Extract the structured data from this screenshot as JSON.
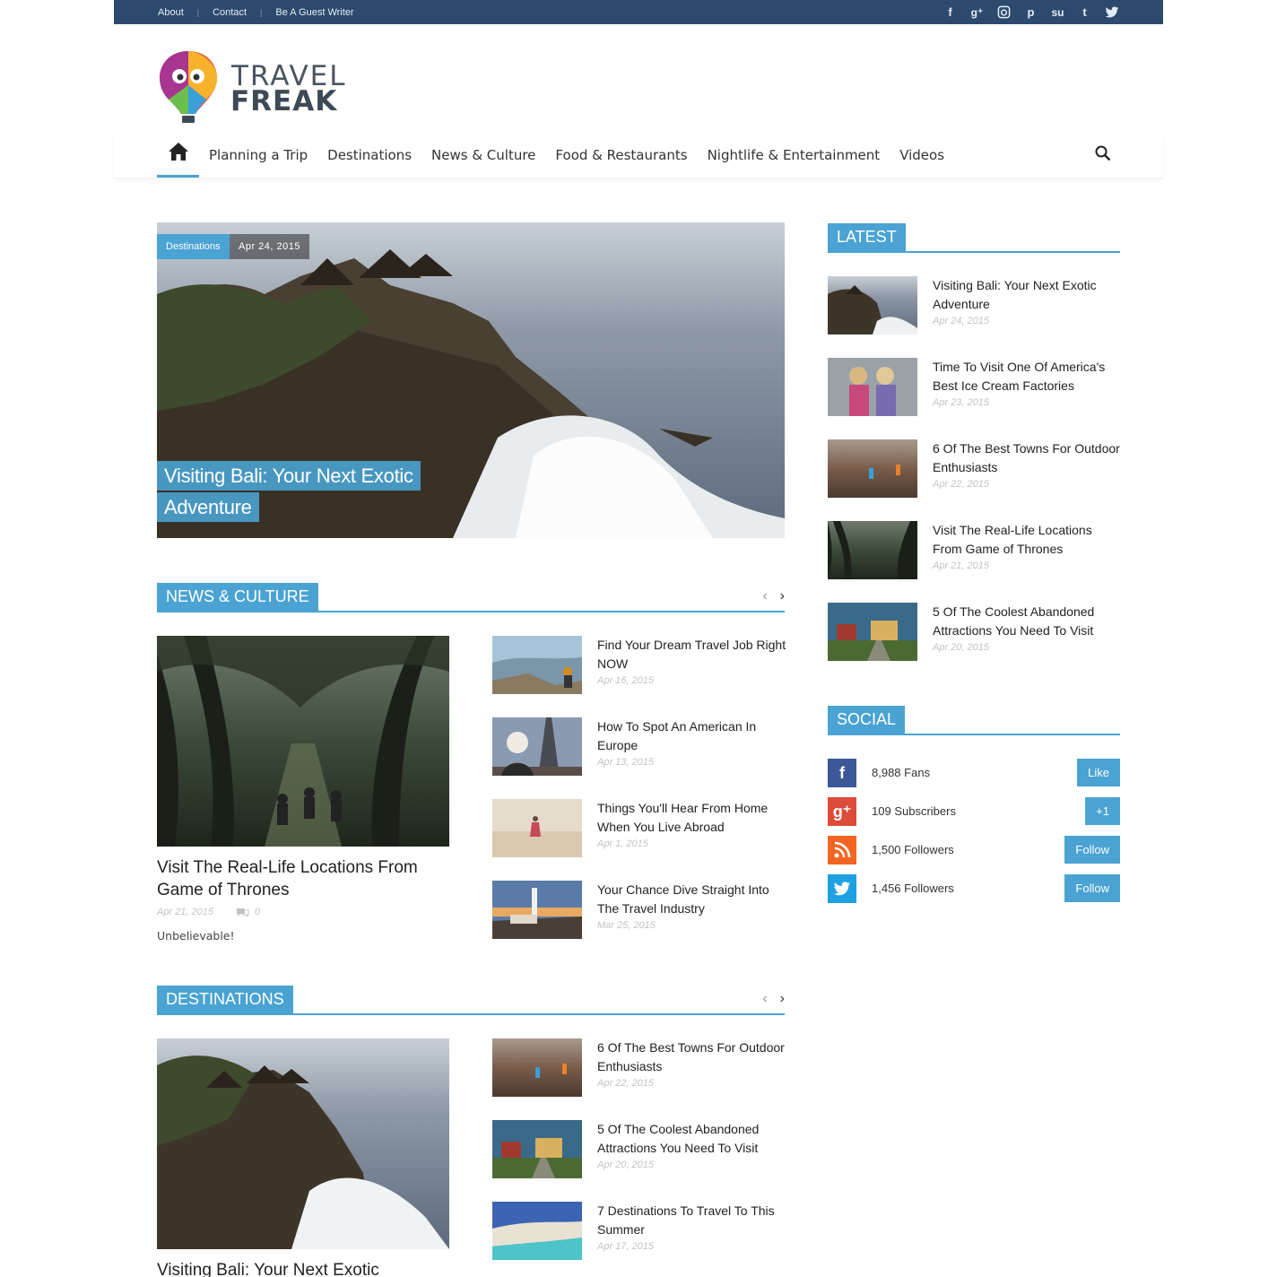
{
  "topbar": {
    "links": [
      "About",
      "Contact",
      "Be A Guest Writer"
    ],
    "social_icons": [
      "facebook-icon",
      "google-plus-icon",
      "instagram-icon",
      "pinterest-icon",
      "stumbleupon-icon",
      "tumblr-icon",
      "twitter-icon"
    ]
  },
  "logo": {
    "line1": "TRAVEL",
    "line2": "FREAK"
  },
  "nav": {
    "items": [
      "Planning a Trip",
      "Destinations",
      "News & Culture",
      "Food & Restaurants",
      "Nightlife & Entertainment",
      "Videos"
    ]
  },
  "hero": {
    "category": "Destinations",
    "date": "Apr 24, 2015",
    "title_line1": "Visiting Bali: Your Next Exotic",
    "title_line2": "Adventure"
  },
  "news_culture": {
    "label": "NEWS & CULTURE",
    "featured": {
      "title": "Visit The Real-Life Locations From Game of Thrones",
      "date": "Apr 21, 2015",
      "comments": "0",
      "excerpt": "Unbelievable!"
    },
    "items": [
      {
        "title": "Find Your Dream Travel Job Right NOW",
        "date": "Apr 16, 2015"
      },
      {
        "title": "How To Spot An American In Europe",
        "date": "Apr 13, 2015"
      },
      {
        "title": "Things You'll Hear From Home When You Live Abroad",
        "date": "Apr 1, 2015"
      },
      {
        "title": "Your Chance Dive Straight Into The Travel Industry",
        "date": "Mar 25, 2015"
      }
    ]
  },
  "destinations": {
    "label": "DESTINATIONS",
    "featured": {
      "title": "Visiting Bali: Your Next Exotic"
    },
    "items": [
      {
        "title": "6 Of The Best Towns For Outdoor Enthusiasts",
        "date": "Apr 22, 2015"
      },
      {
        "title": "5 Of The Coolest Abandoned Attractions You Need To Visit",
        "date": "Apr 20, 2015"
      },
      {
        "title": "7 Destinations To Travel To This Summer",
        "date": "Apr 17, 2015"
      }
    ]
  },
  "latest": {
    "label": "LATEST",
    "items": [
      {
        "title": "Visiting Bali: Your Next Exotic Adventure",
        "date": "Apr 24, 2015"
      },
      {
        "title": "Time To Visit One Of America's Best Ice Cream Factories",
        "date": "Apr 23, 2015"
      },
      {
        "title": "6 Of The Best Towns For Outdoor Enthusiasts",
        "date": "Apr 22, 2015"
      },
      {
        "title": "Visit The Real-Life Locations From Game of Thrones",
        "date": "Apr 21, 2015"
      },
      {
        "title": "5 Of The Coolest Abandoned Attractions You Need To Visit",
        "date": "Apr 20, 2015"
      }
    ]
  },
  "social": {
    "label": "SOCIAL",
    "rows": [
      {
        "count": "8,988",
        "unit": "Fans",
        "button": "Like",
        "color": "#3b5998"
      },
      {
        "count": "109",
        "unit": "Subscribers",
        "button": "+1",
        "color": "#dd4b39"
      },
      {
        "count": "1,500",
        "unit": "Followers",
        "button": "Follow",
        "color": "#f26522"
      },
      {
        "count": "1,456",
        "unit": "Followers",
        "button": "Follow",
        "color": "#1da1e2"
      }
    ]
  },
  "colors": {
    "accent": "#4aa3d3",
    "topbar": "#2c4a6e"
  }
}
